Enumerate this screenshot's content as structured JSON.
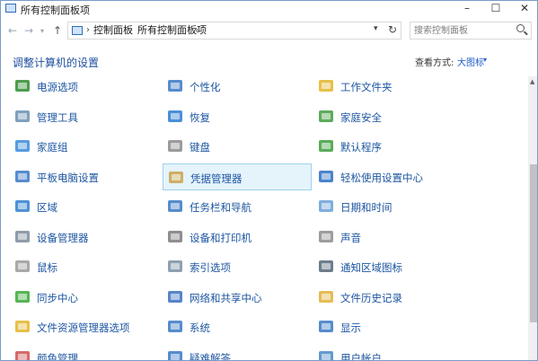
{
  "window": {
    "title": "所有控制面板项",
    "minimize": "–",
    "maximize": "☐",
    "close": "✕"
  },
  "nav": {
    "back": "←",
    "forward": "→",
    "history": "▾",
    "up": "↑",
    "breadcrumb": [
      "控制面板",
      "所有控制面板项"
    ],
    "separator": "›",
    "address_dropdown": "▾",
    "refresh": "↻",
    "search_placeholder": "搜索控制面板"
  },
  "header": {
    "title": "调整计算机的设置",
    "view_by_label": "查看方式:",
    "view_by_value": "大图标",
    "view_by_dropdown": "▾"
  },
  "items": [
    {
      "label": "电源选项",
      "icon": "power-options-icon",
      "color": "#2e8b2e"
    },
    {
      "label": "个性化",
      "icon": "personalization-icon",
      "color": "#3a78c4"
    },
    {
      "label": "工作文件夹",
      "icon": "work-folders-icon",
      "color": "#e3b52a"
    },
    {
      "label": "管理工具",
      "icon": "admin-tools-icon",
      "color": "#6a8fb3"
    },
    {
      "label": "恢复",
      "icon": "recovery-icon",
      "color": "#2c7bd0"
    },
    {
      "label": "家庭安全",
      "icon": "family-safety-icon",
      "color": "#3f9e3f"
    },
    {
      "label": "家庭组",
      "icon": "homegroup-icon",
      "color": "#3a8bd8"
    },
    {
      "label": "键盘",
      "icon": "keyboard-icon",
      "color": "#8a8a8a"
    },
    {
      "label": "默认程序",
      "icon": "default-programs-icon",
      "color": "#3d9e3d"
    },
    {
      "label": "平板电脑设置",
      "icon": "tablet-settings-icon",
      "color": "#3a78c4"
    },
    {
      "label": "凭据管理器",
      "icon": "credential-manager-icon",
      "color": "#c9a24a"
    },
    {
      "label": "轻松使用设置中心",
      "icon": "ease-of-access-icon",
      "color": "#2b6fc2"
    },
    {
      "label": "区域",
      "icon": "region-icon",
      "color": "#2f7fd0"
    },
    {
      "label": "任务栏和导航",
      "icon": "taskbar-icon",
      "color": "#3a78c4"
    },
    {
      "label": "日期和时间",
      "icon": "date-time-icon",
      "color": "#6aa0d8"
    },
    {
      "label": "设备管理器",
      "icon": "device-manager-icon",
      "color": "#7a8a9a"
    },
    {
      "label": "设备和打印机",
      "icon": "devices-printers-icon",
      "color": "#7a7a7a"
    },
    {
      "label": "声音",
      "icon": "sound-icon",
      "color": "#8c8c8c"
    },
    {
      "label": "鼠标",
      "icon": "mouse-icon",
      "color": "#9a9a9a"
    },
    {
      "label": "索引选项",
      "icon": "indexing-options-icon",
      "color": "#7a8fa5"
    },
    {
      "label": "通知区域图标",
      "icon": "notification-area-icon",
      "color": "#556677"
    },
    {
      "label": "同步中心",
      "icon": "sync-center-icon",
      "color": "#38a838"
    },
    {
      "label": "网络和共享中心",
      "icon": "network-sharing-icon",
      "color": "#3a70c0"
    },
    {
      "label": "文件历史记录",
      "icon": "file-history-icon",
      "color": "#e0b03a"
    },
    {
      "label": "文件资源管理器选项",
      "icon": "explorer-options-icon",
      "color": "#e3b52a"
    },
    {
      "label": "系统",
      "icon": "system-icon",
      "color": "#3a78c4"
    },
    {
      "label": "显示",
      "icon": "display-icon",
      "color": "#3a78c4"
    },
    {
      "label": "颜色管理",
      "icon": "color-management-icon",
      "color": "#d05050"
    },
    {
      "label": "疑难解答",
      "icon": "troubleshooting-icon",
      "color": "#3a78c4"
    },
    {
      "label": "用户帐户",
      "icon": "user-accounts-icon",
      "color": "#4a88c8"
    }
  ],
  "selected_item": "凭据管理器",
  "colors": {
    "link": "#1d56a1",
    "heading": "#1e4e9d",
    "selection_bg": "#e5f3fb",
    "selection_border": "#9fd1ee"
  }
}
